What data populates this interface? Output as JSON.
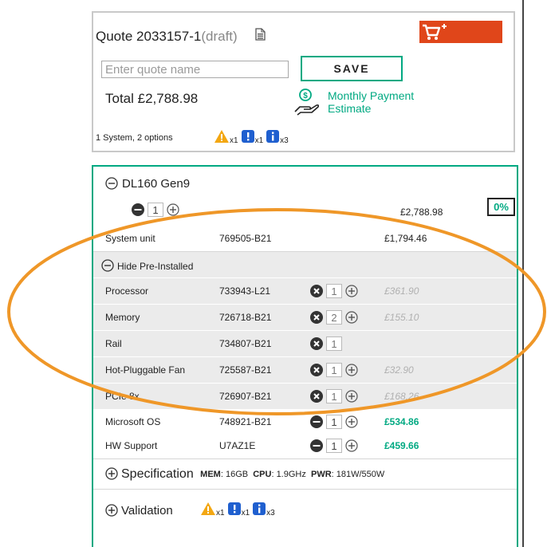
{
  "colors": {
    "accent": "#01a982",
    "cart": "#e0461a",
    "warning": "#f3a712",
    "info": "#1f5fcf",
    "annotation": "#ef9728"
  },
  "quote": {
    "title": "Quote 2033157-1",
    "status": "(draft)",
    "name_placeholder": "Enter quote name",
    "save_label": "SAVE",
    "total": "Total £2,788.98",
    "monthly_line1": "Monthly Payment",
    "monthly_line2": "Estimate",
    "summary": "1 System, 2 options",
    "alerts": [
      {
        "icon": "warning-icon",
        "count": "x1"
      },
      {
        "icon": "exclamation-icon",
        "count": "x1"
      },
      {
        "icon": "info-icon",
        "count": "x3"
      }
    ]
  },
  "product": {
    "name": "DL160 Gen9",
    "qty": "1",
    "price": "£2,788.98",
    "discount": "0%",
    "system_unit": {
      "name": "System unit",
      "part": "769505-B21",
      "price": "£1,794.46"
    },
    "hide_preinstalled": "Hide Pre-Installed",
    "preinstalled": [
      {
        "name": "Processor",
        "part": "733943-L21",
        "qty": "1",
        "price": "£361.90"
      },
      {
        "name": "Memory",
        "part": "726718-B21",
        "qty": "2",
        "price": "£155.10"
      },
      {
        "name": "Rail",
        "part": "734807-B21",
        "qty": "1",
        "price": ""
      },
      {
        "name": "Hot-Pluggable Fan",
        "part": "725587-B21",
        "qty": "1",
        "price": "£32.90"
      },
      {
        "name": "PCIe 8x",
        "part": "726907-B21",
        "qty": "1",
        "price": "£168.26"
      }
    ],
    "options": [
      {
        "name": "Microsoft OS",
        "part": "748921-B21",
        "qty": "1",
        "price": "£534.86"
      },
      {
        "name": "HW Support",
        "part": "U7AZ1E",
        "qty": "1",
        "price": "£459.66"
      }
    ],
    "specification": {
      "label": "Specification",
      "mem_key": "MEM",
      "mem_val": ": 16GB",
      "cpu_key": "CPU",
      "cpu_val": ": 1.9GHz",
      "pwr_key": "PWR",
      "pwr_val": ": 181W/550W"
    },
    "validation": {
      "label": "Validation",
      "alerts": [
        {
          "icon": "warning-icon",
          "count": "x1"
        },
        {
          "icon": "exclamation-icon",
          "count": "x1"
        },
        {
          "icon": "info-icon",
          "count": "x3"
        }
      ]
    }
  }
}
